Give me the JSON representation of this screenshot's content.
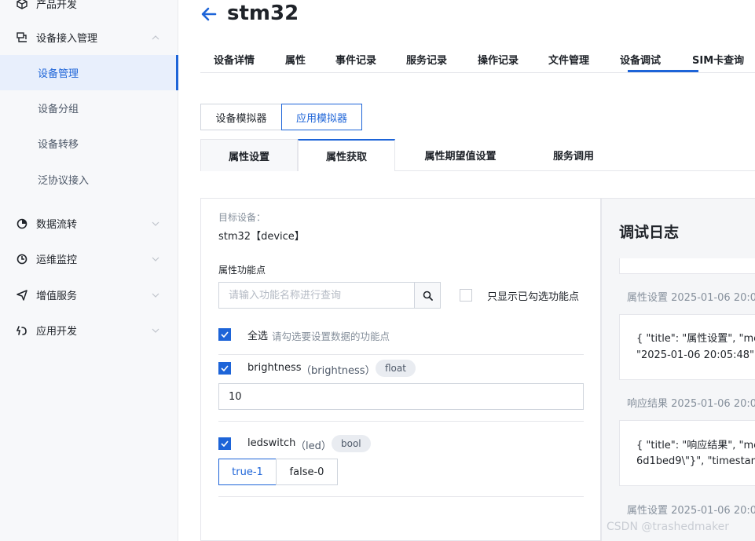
{
  "sidebar": {
    "items": [
      {
        "label": "产品开发",
        "icon": "cube-icon"
      },
      {
        "label": "设备接入管理",
        "icon": "device-access-icon"
      },
      {
        "label": "数据流转",
        "icon": "data-flow-icon"
      },
      {
        "label": "运维监控",
        "icon": "monitor-icon"
      },
      {
        "label": "增值服务",
        "icon": "send-icon"
      },
      {
        "label": "应用开发",
        "icon": "app-dev-icon"
      }
    ],
    "sub_items": [
      {
        "label": "设备管理"
      },
      {
        "label": "设备分组"
      },
      {
        "label": "设备转移"
      },
      {
        "label": "泛协议接入"
      }
    ],
    "active_sub": "设备管理"
  },
  "header": {
    "title": "stm32"
  },
  "tabs": [
    {
      "label": "设备详情"
    },
    {
      "label": "属性"
    },
    {
      "label": "事件记录"
    },
    {
      "label": "服务记录"
    },
    {
      "label": "操作记录"
    },
    {
      "label": "文件管理"
    },
    {
      "label": "设备调试"
    },
    {
      "label": "SIM卡查询"
    }
  ],
  "active_tab": "设备调试",
  "simulator": {
    "device": "设备模拟器",
    "app": "应用模拟器",
    "active": "应用模拟器"
  },
  "subtabs": [
    {
      "label": "属性设置"
    },
    {
      "label": "属性获取"
    },
    {
      "label": "属性期望值设置"
    },
    {
      "label": "服务调用"
    }
  ],
  "active_subtab": "属性获取",
  "form": {
    "target_label": "目标设备：",
    "target_value": "stm32【device】",
    "feature_label": "属性功能点",
    "search_placeholder": "请输入功能名称进行查询",
    "only_checked_label": "只显示已勾选功能点",
    "select_all_label": "全选",
    "select_all_hint": "请勾选要设置数据的功能点",
    "properties": [
      {
        "name": "brightness",
        "id": "（brightness）",
        "type": "float",
        "value": "10",
        "checked": true
      },
      {
        "name": "ledswitch",
        "id": "（led）",
        "type": "bool",
        "options": [
          "true-1",
          "false-0"
        ],
        "selected": "true-1",
        "checked": true
      }
    ]
  },
  "log": {
    "title": "调试日志",
    "entries": [
      {
        "head": "属性设置 2025-01-06 20:0",
        "line1": "{ \"title\": \"属性设置\", \"mes",
        "line2": "\"2025-01-06 20:05:48\" }"
      },
      {
        "head": "响应结果 2025-01-06 20:0",
        "line1": "{ \"title\": \"响应结果\", \"mes",
        "line2": "6d1bed9\\\"}\", \"timestamp"
      },
      {
        "head": "属性设置 2025-01-06 20:0"
      }
    ]
  },
  "watermark": "CSDN @trashedmaker",
  "colors": {
    "accent": "#1d64d8",
    "text": "#1f2329",
    "muted": "#86909c"
  }
}
